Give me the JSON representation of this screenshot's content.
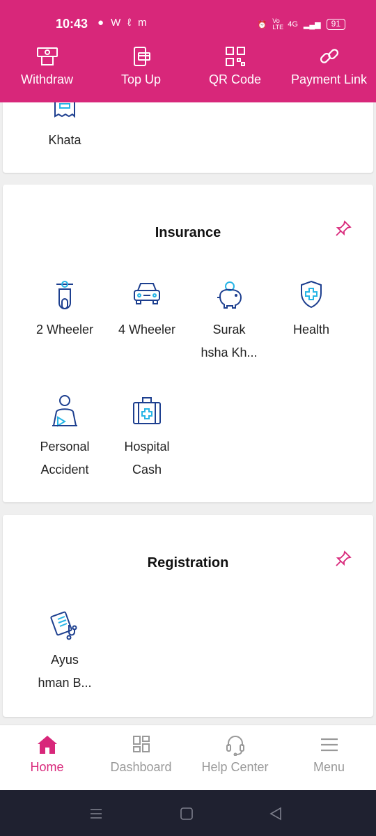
{
  "status_bar": {
    "time": "10:43",
    "battery": "91",
    "network": "4G",
    "volte": "Vo LTE"
  },
  "quick_actions": [
    {
      "label": "Withdraw",
      "icon": "withdraw-icon"
    },
    {
      "label": "Top Up",
      "icon": "top-up-icon"
    },
    {
      "label": "QR Code",
      "icon": "qr-code-icon"
    },
    {
      "label": "Payment Link",
      "icon": "link-icon"
    }
  ],
  "khata_card": {
    "label": "Khata"
  },
  "insurance_card": {
    "title": "Insurance",
    "items": [
      {
        "line1": "2 Wheeler",
        "line2": ""
      },
      {
        "line1": "4 Wheeler",
        "line2": ""
      },
      {
        "line1": "Surak",
        "line2": "hsha Kh..."
      },
      {
        "line1": "Health",
        "line2": ""
      },
      {
        "line1": "Personal",
        "line2": "Accident"
      },
      {
        "line1": "Hospital",
        "line2": "Cash"
      }
    ]
  },
  "registration_card": {
    "title": "Registration",
    "items": [
      {
        "line1": "Ayus",
        "line2": "hman B..."
      }
    ]
  },
  "bottom_nav": [
    {
      "label": "Home",
      "active": true
    },
    {
      "label": "Dashboard",
      "active": false
    },
    {
      "label": "Help Center",
      "active": false
    },
    {
      "label": "Menu",
      "active": false
    }
  ],
  "colors": {
    "brand": "#d8277a",
    "icon_blue": "#1d3f8f",
    "icon_cyan": "#27b5e6",
    "inactive": "#999999",
    "system_nav": "#1f2130"
  }
}
